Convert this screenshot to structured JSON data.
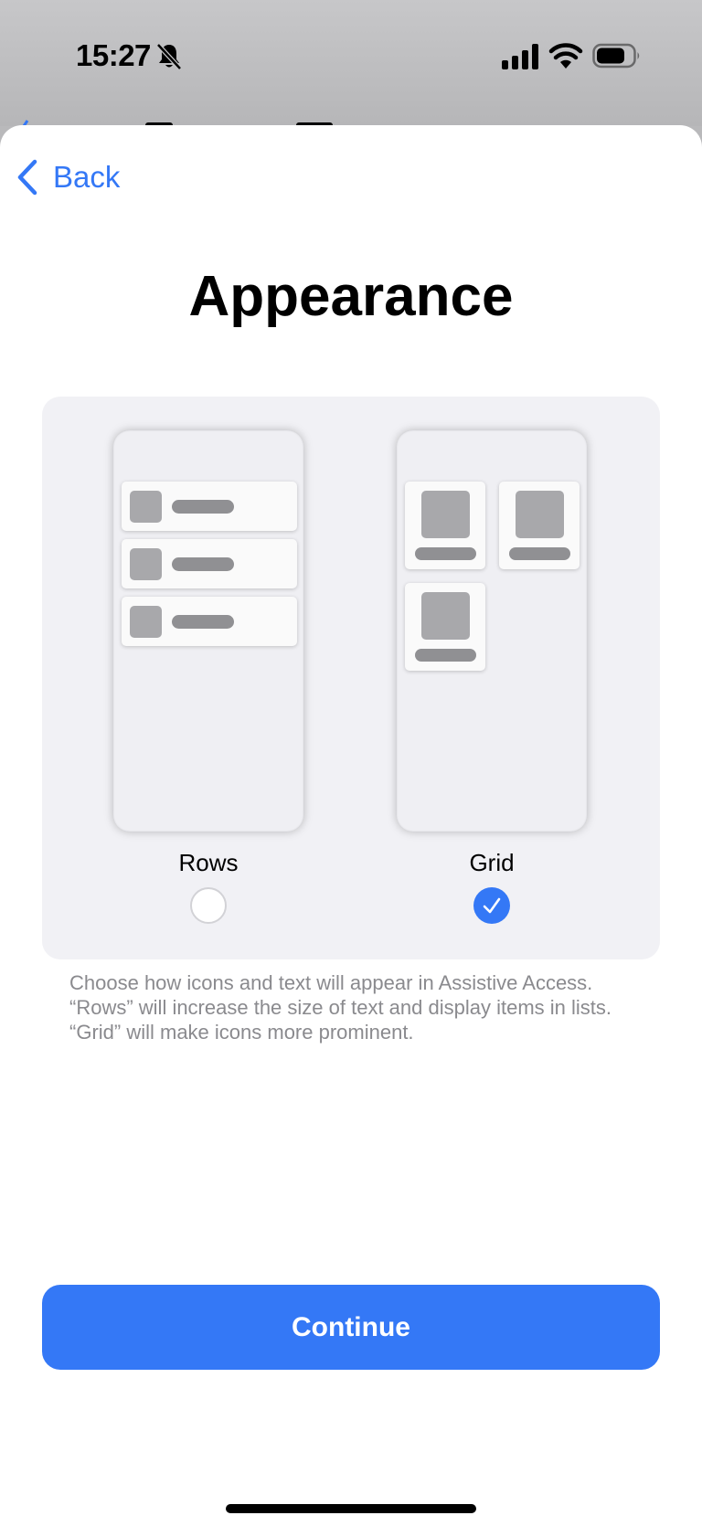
{
  "status_bar": {
    "time": "15:27",
    "icons": [
      "bell-slash-icon",
      "cellular-signal-icon",
      "wifi-icon",
      "battery-icon"
    ]
  },
  "nav": {
    "back_label": "Back"
  },
  "page": {
    "title": "Appearance"
  },
  "options": [
    {
      "label": "Rows",
      "selected": false
    },
    {
      "label": "Grid",
      "selected": true
    }
  ],
  "description": "Choose how icons and text will appear in Assistive Access. “Rows” will increase the size of text and display items in lists. “Grid” will make icons more prominent.",
  "continue_label": "Continue",
  "colors": {
    "accent": "#3478f6",
    "card_background": "#f1f1f5",
    "secondary_text": "#8a8a8e"
  }
}
